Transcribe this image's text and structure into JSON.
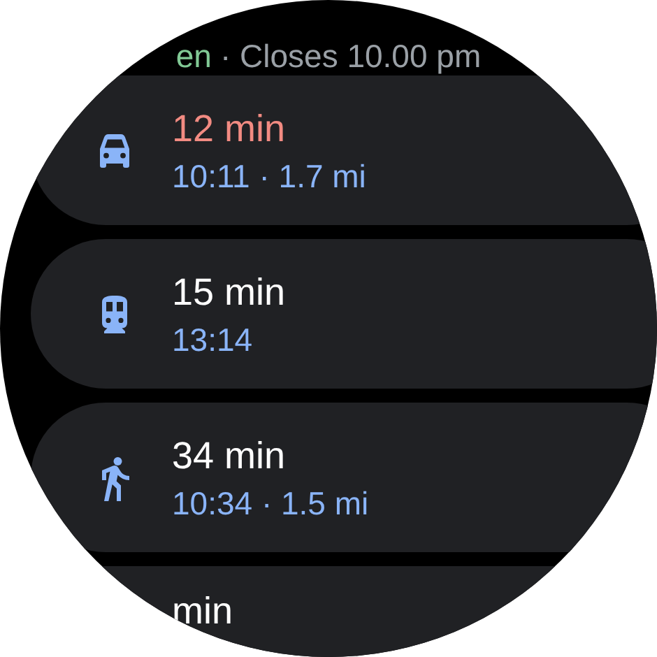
{
  "status": {
    "open_text": "en",
    "closes_text": "· Closes 10.00 pm"
  },
  "routes": [
    {
      "kind": "car",
      "duration": "12 min",
      "delayed": true,
      "details": "10:11 · 1.7 mi"
    },
    {
      "kind": "train",
      "duration": "15 min",
      "delayed": false,
      "details": "13:14"
    },
    {
      "kind": "walk",
      "duration": "34 min",
      "delayed": false,
      "details": "10:34 · 1.5 mi"
    },
    {
      "kind": "other",
      "duration": "min",
      "delayed": false
    }
  ]
}
